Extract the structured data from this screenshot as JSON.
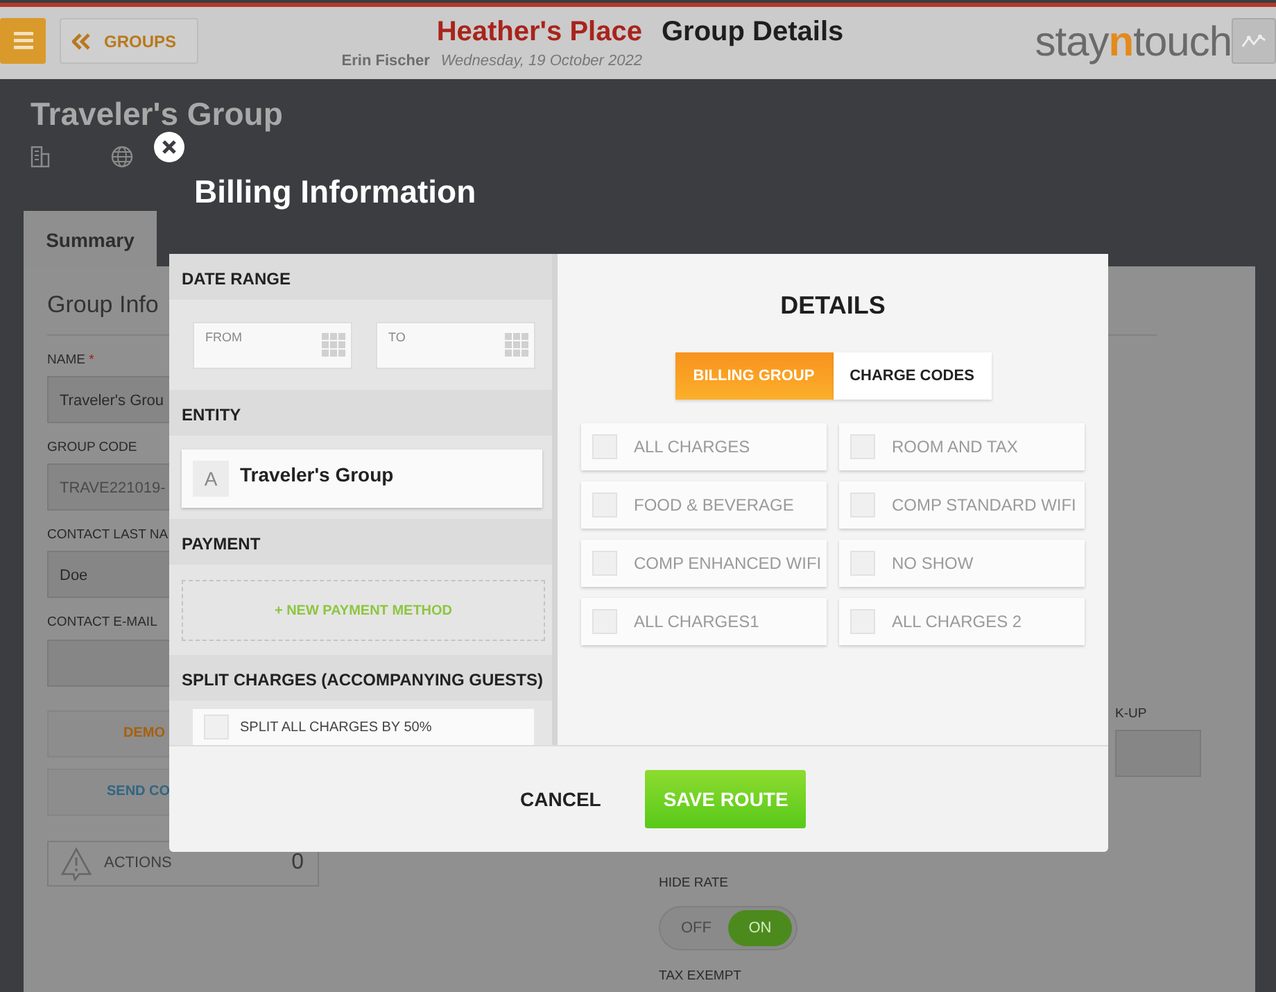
{
  "header": {
    "groups_button": "GROUPS",
    "property": "Heather's Place",
    "page_title": "Group Details",
    "user": "Erin Fischer",
    "date": "Wednesday, 19 October 2022",
    "logo": [
      {
        "text": "stay",
        "accent": false
      },
      {
        "text": "n",
        "accent": true
      },
      {
        "text": "touch",
        "accent": false
      }
    ]
  },
  "group": {
    "title": "Traveler's Group"
  },
  "tabs": [
    {
      "label": "Summary",
      "selected": true
    }
  ],
  "group_info": {
    "heading": "Group Info",
    "fields": [
      {
        "label": "NAME",
        "required_mark": "*",
        "disabled": false,
        "value": "Traveler's Grou"
      },
      {
        "label": "GROUP CODE",
        "disabled": true,
        "value": "TRAVE221019-"
      },
      {
        "label": "CONTACT LAST NA",
        "disabled": false,
        "value": "Doe"
      },
      {
        "label": "CONTACT E-MAIL"
      }
    ],
    "buttons": [
      {
        "label": "DEMO",
        "color": "#a85f0c"
      },
      {
        "label": "SEND CO",
        "color": "#2f6682"
      }
    ],
    "actions": {
      "label": "ACTIONS",
      "count": "0"
    }
  },
  "column_3": {
    "label": "K-UP"
  },
  "hide_rate": {
    "label": "HIDE RATE",
    "off": "OFF",
    "on": "ON",
    "on_selected": true
  },
  "tax_exempt": {
    "label": "TAX EXEMPT"
  },
  "modal": {
    "title": "Billing Information",
    "date_range": {
      "heading": "DATE RANGE",
      "fields": [
        {
          "label": "FROM"
        },
        {
          "label": "TO"
        }
      ]
    },
    "entity": {
      "heading": "ENTITY",
      "avatar": "A",
      "name": "Traveler's Group"
    },
    "payment": {
      "heading": "PAYMENT",
      "add": "+ NEW PAYMENT METHOD"
    },
    "split": {
      "heading": "SPLIT CHARGES (ACCOMPANYING GUESTS)",
      "options": [
        {
          "label": "SPLIT ALL CHARGES BY 50%",
          "checked": false
        }
      ]
    },
    "details": {
      "heading": "DETAILS",
      "tabs": [
        {
          "label": "BILLING GROUP",
          "selected": true
        },
        {
          "label": "CHARGE CODES",
          "selected": false
        }
      ],
      "options": [
        {
          "label": "ALL CHARGES",
          "checked": false
        },
        {
          "label": "ROOM AND TAX",
          "checked": false
        },
        {
          "label": "FOOD & BEVERAGE",
          "checked": false
        },
        {
          "label": "COMP STANDARD WIFI",
          "checked": false
        },
        {
          "label": "COMP ENHANCED WIFI",
          "checked": false
        },
        {
          "label": "NO SHOW",
          "checked": false
        },
        {
          "label": "ALL CHARGES1",
          "checked": false
        },
        {
          "label": "ALL CHARGES 2",
          "checked": false
        }
      ]
    },
    "cancel": "CANCEL",
    "save": "SAVE ROUTE"
  }
}
